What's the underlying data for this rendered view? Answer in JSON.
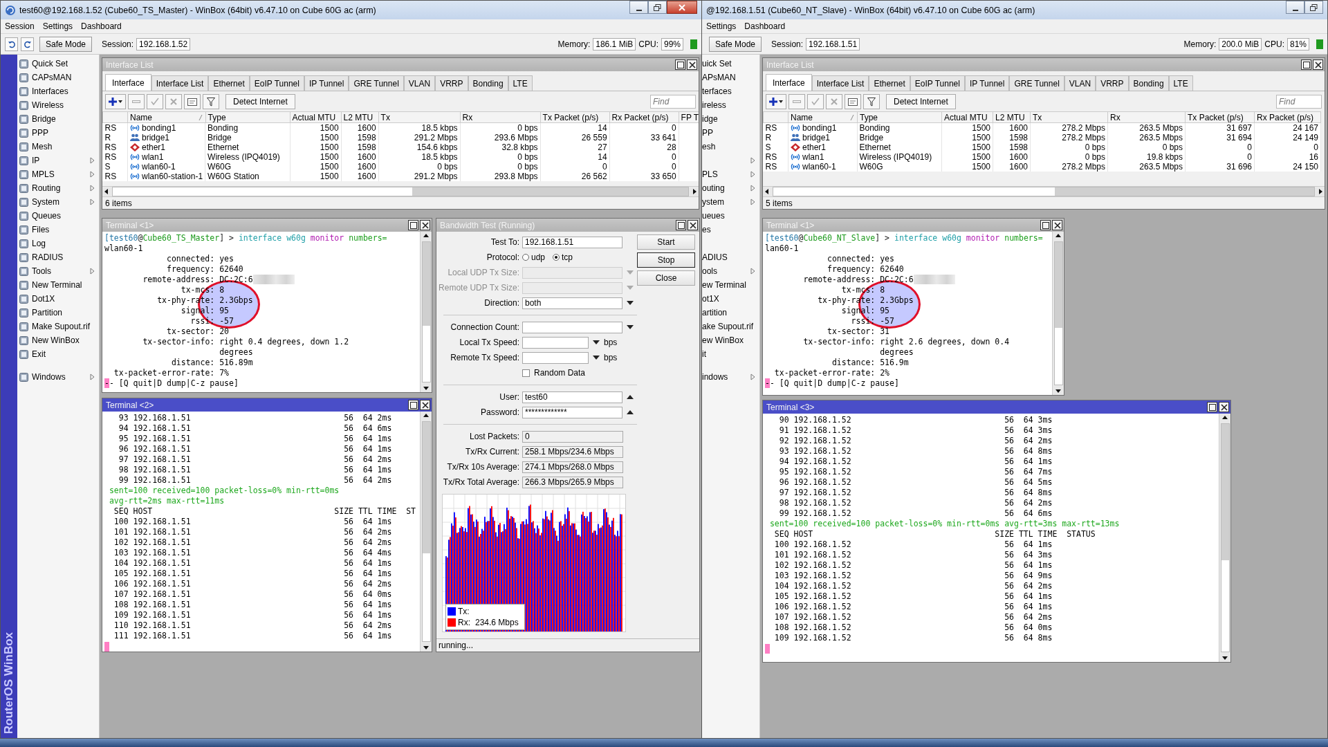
{
  "windows": [
    {
      "title": "test60@192.168.1.52 (Cube60_TS_Master) - WinBox (64bit) v6.47.10 on Cube 60G ac (arm)",
      "logo": true,
      "controls": [
        {
          "kind": "minimize"
        },
        {
          "kind": "restore"
        },
        {
          "kind": "close"
        }
      ],
      "menu": [
        "Session",
        "Settings",
        "Dashboard"
      ],
      "toolbar": {
        "history": true,
        "safe_mode": "Safe Mode",
        "session_label": "Session:",
        "session": "192.168.1.52",
        "memory_label": "Memory:",
        "memory": "186.1 MiB",
        "cpu_label": "CPU:",
        "cpu": "99%"
      },
      "brand": "RouterOS WinBox",
      "sidebar": {
        "icons": true,
        "items": [
          {
            "label": "Quick Set",
            "submenu": false
          },
          {
            "label": "CAPsMAN",
            "submenu": false
          },
          {
            "label": "Interfaces",
            "submenu": false
          },
          {
            "label": "Wireless",
            "submenu": false
          },
          {
            "label": "Bridge",
            "submenu": false
          },
          {
            "label": "PPP",
            "submenu": false
          },
          {
            "label": "Mesh",
            "submenu": false
          },
          {
            "label": "IP",
            "submenu": true
          },
          {
            "label": "MPLS",
            "submenu": true
          },
          {
            "label": "Routing",
            "submenu": true
          },
          {
            "label": "System",
            "submenu": true
          },
          {
            "label": "Queues",
            "submenu": false
          },
          {
            "label": "Files",
            "submenu": false
          },
          {
            "label": "Log",
            "submenu": false
          },
          {
            "label": "RADIUS",
            "submenu": false
          },
          {
            "label": "Tools",
            "submenu": true
          },
          {
            "label": "New Terminal",
            "submenu": false
          },
          {
            "label": "Dot1X",
            "submenu": false
          },
          {
            "label": "Partition",
            "submenu": false
          },
          {
            "label": "Make Supout.rif",
            "submenu": false
          },
          {
            "label": "New WinBox",
            "submenu": false
          },
          {
            "label": "Exit",
            "submenu": false
          }
        ],
        "bottom_items": [
          {
            "label": "Windows",
            "submenu": true
          }
        ]
      },
      "interface_list": {
        "title": "Interface List",
        "active": false,
        "tabs": [
          {
            "label": "Interface",
            "selected": true
          },
          {
            "label": "Interface List",
            "selected": false
          },
          {
            "label": "Ethernet",
            "selected": false
          },
          {
            "label": "EoIP Tunnel",
            "selected": false
          },
          {
            "label": "IP Tunnel",
            "selected": false
          },
          {
            "label": "GRE Tunnel",
            "selected": false
          },
          {
            "label": "VLAN",
            "selected": false
          },
          {
            "label": "VRRP",
            "selected": false
          },
          {
            "label": "Bonding",
            "selected": false
          },
          {
            "label": "LTE",
            "selected": false
          }
        ],
        "detect": "Detect Internet",
        "find_placeholder": "Find",
        "columns": [
          "Name",
          "Type",
          "Actual MTU",
          "L2 MTU",
          "Tx",
          "Rx",
          "Tx Packet (p/s)",
          "Rx Packet (p/s)",
          "FP T"
        ],
        "rows": [
          {
            "flags": "RS",
            "kind": "bonding",
            "name": "bonding1",
            "type": "Bonding",
            "actual_mtu": "1500",
            "l2_mtu": "1600",
            "tx": "18.5 kbps",
            "rx": "0 bps",
            "tx_packet": "14",
            "rx_packet": "0"
          },
          {
            "flags": "R",
            "kind": "bridge",
            "name": "bridge1",
            "type": "Bridge",
            "actual_mtu": "1500",
            "l2_mtu": "1598",
            "tx": "291.2 Mbps",
            "rx": "293.6 Mbps",
            "tx_packet": "26 559",
            "rx_packet": "33 641"
          },
          {
            "flags": "RS",
            "kind": "ethernet",
            "name": "ether1",
            "type": "Ethernet",
            "actual_mtu": "1500",
            "l2_mtu": "1598",
            "tx": "154.6 kbps",
            "rx": "32.8 kbps",
            "tx_packet": "27",
            "rx_packet": "28"
          },
          {
            "flags": "RS",
            "kind": "wireless",
            "name": "wlan1",
            "type": "Wireless (IPQ4019)",
            "actual_mtu": "1500",
            "l2_mtu": "1600",
            "tx": "18.5 kbps",
            "rx": "0 bps",
            "tx_packet": "14",
            "rx_packet": "0"
          },
          {
            "flags": "S",
            "kind": "wireless",
            "name": "wlan60-1",
            "type": "W60G",
            "actual_mtu": "1500",
            "l2_mtu": "1600",
            "tx": "0 bps",
            "rx": "0 bps",
            "tx_packet": "0",
            "rx_packet": "0"
          },
          {
            "flags": "RS",
            "kind": "wireless",
            "name": "wlan60-station-1",
            "type": "W60G Station",
            "actual_mtu": "1500",
            "l2_mtu": "1600",
            "tx": "291.2 Mbps",
            "rx": "293.8 Mbps",
            "tx_packet": "26 562",
            "rx_packet": "33 650"
          }
        ],
        "status": "6 items"
      },
      "terminals": [
        {
          "title": "Terminal <1>",
          "active": false,
          "highlight": true,
          "lines": [
            {
              "kind": "prompt",
              "parts": [
                {
                  "kind": "user",
                  "text": "[test60"
                },
                {
                  "kind": "plain",
                  "text": "@"
                },
                {
                  "kind": "host",
                  "text": "Cube60_TS_Master"
                },
                {
                  "kind": "plain",
                  "text": "] > "
                },
                {
                  "kind": "command",
                  "text": "interface w60g "
                },
                {
                  "kind": "keyword",
                  "text": "monitor "
                },
                {
                  "kind": "arg",
                  "text": "numbers="
                }
              ]
            },
            {
              "kind": "text",
              "text": "wlan60-1"
            },
            {
              "kind": "field",
              "label": "connected:",
              "value": "yes"
            },
            {
              "kind": "field",
              "label": "frequency:",
              "value": "62640"
            },
            {
              "kind": "field",
              "label": "remote-address:",
              "value": "DC:2C:6",
              "redacted": true
            },
            {
              "kind": "field",
              "label": "tx-mcs:",
              "value": "8"
            },
            {
              "kind": "field",
              "label": "tx-phy-rate:",
              "value": "2.3Gbps"
            },
            {
              "kind": "field",
              "label": "signal:",
              "value": "95"
            },
            {
              "kind": "field",
              "label": "rssi:",
              "value": "-57"
            },
            {
              "kind": "field",
              "label": "tx-sector:",
              "value": "20"
            },
            {
              "kind": "field",
              "label": "tx-sector-info:",
              "value": "right 0.4 degrees, down 1.2"
            },
            {
              "kind": "field",
              "value": "degrees"
            },
            {
              "kind": "field",
              "label": "distance:",
              "value": "516.89m"
            },
            {
              "kind": "field",
              "label": "tx-packet-error-rate:",
              "value": "7%"
            },
            {
              "kind": "status",
              "mark": "-",
              "text": "- [Q quit|D dump|C-z pause]"
            }
          ]
        },
        {
          "title": "Terminal <2>",
          "active": true,
          "highlight": false,
          "lines": [
            {
              "kind": "ping",
              "cols": [
                "93",
                "192.168.1.51",
                "56",
                "64",
                "2ms"
              ]
            },
            {
              "kind": "ping",
              "cols": [
                "94",
                "192.168.1.51",
                "56",
                "64",
                "6ms"
              ]
            },
            {
              "kind": "ping",
              "cols": [
                "95",
                "192.168.1.51",
                "56",
                "64",
                "1ms"
              ]
            },
            {
              "kind": "ping",
              "cols": [
                "96",
                "192.168.1.51",
                "56",
                "64",
                "1ms"
              ]
            },
            {
              "kind": "ping",
              "cols": [
                "97",
                "192.168.1.51",
                "56",
                "64",
                "2ms"
              ]
            },
            {
              "kind": "ping",
              "cols": [
                "98",
                "192.168.1.51",
                "56",
                "64",
                "1ms"
              ]
            },
            {
              "kind": "ping",
              "cols": [
                "99",
                "192.168.1.51",
                "56",
                "64",
                "2ms"
              ]
            },
            {
              "kind": "summary",
              "text": "sent=100 received=100 packet-loss=0% min-rtt=0ms"
            },
            {
              "kind": "summary",
              "text": "avg-rtt=2ms max-rtt=11ms"
            },
            {
              "kind": "header",
              "cols": [
                "SEQ",
                "HOST",
                "SIZE",
                "TTL",
                "TIME",
                "ST"
              ]
            },
            {
              "kind": "ping",
              "cols": [
                "100",
                "192.168.1.51",
                "56",
                "64",
                "1ms"
              ]
            },
            {
              "kind": "ping",
              "cols": [
                "101",
                "192.168.1.51",
                "56",
                "64",
                "2ms"
              ]
            },
            {
              "kind": "ping",
              "cols": [
                "102",
                "192.168.1.51",
                "56",
                "64",
                "2ms"
              ]
            },
            {
              "kind": "ping",
              "cols": [
                "103",
                "192.168.1.51",
                "56",
                "64",
                "4ms"
              ]
            },
            {
              "kind": "ping",
              "cols": [
                "104",
                "192.168.1.51",
                "56",
                "64",
                "1ms"
              ]
            },
            {
              "kind": "ping",
              "cols": [
                "105",
                "192.168.1.51",
                "56",
                "64",
                "1ms"
              ]
            },
            {
              "kind": "ping",
              "cols": [
                "106",
                "192.168.1.51",
                "56",
                "64",
                "2ms"
              ]
            },
            {
              "kind": "ping",
              "cols": [
                "107",
                "192.168.1.51",
                "56",
                "64",
                "0ms"
              ]
            },
            {
              "kind": "ping",
              "cols": [
                "108",
                "192.168.1.51",
                "56",
                "64",
                "1ms"
              ]
            },
            {
              "kind": "ping",
              "cols": [
                "109",
                "192.168.1.51",
                "56",
                "64",
                "1ms"
              ]
            },
            {
              "kind": "ping",
              "cols": [
                "110",
                "192.168.1.51",
                "56",
                "64",
                "2ms"
              ]
            },
            {
              "kind": "ping",
              "cols": [
                "111",
                "192.168.1.51",
                "56",
                "64",
                "1ms"
              ]
            },
            {
              "kind": "cursor"
            }
          ]
        }
      ],
      "bandwidth_test": {
        "title": "Bandwidth Test (Running)",
        "active": false,
        "rows": [
          {
            "kind": "input",
            "label": "Test To:",
            "value": "192.168.1.51",
            "disabled": false
          },
          {
            "kind": "radio",
            "label": "Protocol:",
            "disabled": false,
            "options": [
              {
                "label": "udp",
                "selected": false
              },
              {
                "label": "tcp",
                "selected": true
              }
            ]
          },
          {
            "kind": "dropdown",
            "label": "Local UDP Tx Size:",
            "disabled": true
          },
          {
            "kind": "dropdown",
            "label": "Remote UDP Tx Size:",
            "disabled": true
          },
          {
            "kind": "dropdown",
            "label": "Direction:",
            "value": "both",
            "disabled": false
          },
          {
            "kind": "separator"
          },
          {
            "kind": "dropdown",
            "label": "Connection Count:",
            "disabled": false
          },
          {
            "kind": "speed",
            "label": "Local Tx Speed:",
            "unit": "bps",
            "disabled": false
          },
          {
            "kind": "speed",
            "label": "Remote Tx Speed:",
            "unit": "bps",
            "disabled": false
          },
          {
            "kind": "checkbox",
            "label": "Random Data",
            "checked": false,
            "disabled": false
          },
          {
            "kind": "separator"
          },
          {
            "kind": "collapsible",
            "label": "User:",
            "value": "test60",
            "disabled": false
          },
          {
            "kind": "collapsible",
            "label": "Password:",
            "value": "*************",
            "disabled": false
          },
          {
            "kind": "separator"
          },
          {
            "kind": "readonly",
            "label": "Lost Packets:",
            "value": "0",
            "disabled": false
          },
          {
            "kind": "readonly",
            "label": "Tx/Rx Current:",
            "value": "258.1 Mbps/234.6 Mbps",
            "disabled": false
          },
          {
            "kind": "readonly",
            "label": "Tx/Rx 10s Average:",
            "value": "274.1 Mbps/268.0 Mbps",
            "disabled": false
          },
          {
            "kind": "readonly",
            "label": "Tx/Rx Total Average:",
            "value": "266.3 Mbps/265.9 Mbps",
            "disabled": false
          }
        ],
        "buttons": [
          {
            "label": "Start",
            "focused": false
          },
          {
            "label": "Stop",
            "focused": true
          },
          {
            "label": "Close",
            "focused": false
          }
        ],
        "legend": [
          {
            "label": "Tx:",
            "color": "#0000ff"
          },
          {
            "label": "Rx:",
            "value": "234.6 Mbps",
            "color": "#ff0000"
          }
        ],
        "status": "running..."
      }
    },
    {
      "title": "@192.168.1.51 (Cube60_NT_Slave) - WinBox (64bit) v6.47.10 on Cube 60G ac (arm)",
      "logo": false,
      "controls": [
        {
          "kind": "minimize"
        },
        {
          "kind": "restore"
        }
      ],
      "menu": [
        "Settings",
        "Dashboard"
      ],
      "toolbar": {
        "history": false,
        "safe_mode": "Safe Mode",
        "session_label": "Session:",
        "session": "192.168.1.51",
        "memory_label": "Memory:",
        "memory": "200.0 MiB",
        "cpu_label": "CPU:",
        "cpu": "81%"
      },
      "sidebar": {
        "icons": false,
        "items": [
          {
            "label": "uick Set",
            "submenu": false
          },
          {
            "label": "APsMAN",
            "submenu": false
          },
          {
            "label": "terfaces",
            "submenu": false
          },
          {
            "label": "ireless",
            "submenu": false
          },
          {
            "label": "idge",
            "submenu": false
          },
          {
            "label": "PP",
            "submenu": false
          },
          {
            "label": "esh",
            "submenu": false
          },
          {
            "submenu": true
          },
          {
            "label": "PLS",
            "submenu": true
          },
          {
            "label": "outing",
            "submenu": true
          },
          {
            "label": "ystem",
            "submenu": true
          },
          {
            "label": "ueues",
            "submenu": false
          },
          {
            "label": "es",
            "submenu": false
          },
          {
            "submenu": false
          },
          {
            "label": "ADIUS",
            "submenu": false
          },
          {
            "label": "ools",
            "submenu": true
          },
          {
            "label": "ew Terminal",
            "submenu": false
          },
          {
            "label": "ot1X",
            "submenu": false
          },
          {
            "label": "artition",
            "submenu": false
          },
          {
            "label": "ake Supout.rif",
            "submenu": false
          },
          {
            "label": "ew WinBox",
            "submenu": false
          },
          {
            "label": "it",
            "submenu": false
          }
        ],
        "bottom_items": [
          {
            "label": "indows",
            "submenu": true
          }
        ]
      },
      "interface_list": {
        "title": "Interface List",
        "active": false,
        "tabs": [
          {
            "label": "Interface",
            "selected": true
          },
          {
            "label": "Interface List",
            "selected": false
          },
          {
            "label": "Ethernet",
            "selected": false
          },
          {
            "label": "EoIP Tunnel",
            "selected": false
          },
          {
            "label": "IP Tunnel",
            "selected": false
          },
          {
            "label": "GRE Tunnel",
            "selected": false
          },
          {
            "label": "VLAN",
            "selected": false
          },
          {
            "label": "VRRP",
            "selected": false
          },
          {
            "label": "Bonding",
            "selected": false
          },
          {
            "label": "LTE",
            "selected": false
          }
        ],
        "detect": "Detect Internet",
        "find_placeholder": "Find",
        "columns": [
          "Name",
          "Type",
          "Actual MTU",
          "L2 MTU",
          "Tx",
          "Rx",
          "Tx Packet (p/s)",
          "Rx Packet (p/s)"
        ],
        "rows": [
          {
            "flags": "RS",
            "kind": "bonding",
            "name": "bonding1",
            "type": "Bonding",
            "actual_mtu": "1500",
            "l2_mtu": "1600",
            "tx": "278.2 Mbps",
            "rx": "263.5 Mbps",
            "tx_packet": "31 697",
            "rx_packet": "24 167"
          },
          {
            "flags": "R",
            "kind": "bridge",
            "name": "bridge1",
            "type": "Bridge",
            "actual_mtu": "1500",
            "l2_mtu": "1598",
            "tx": "278.2 Mbps",
            "rx": "263.5 Mbps",
            "tx_packet": "31 694",
            "rx_packet": "24 149"
          },
          {
            "flags": "S",
            "kind": "ethernet",
            "name": "ether1",
            "type": "Ethernet",
            "actual_mtu": "1500",
            "l2_mtu": "1598",
            "tx": "0 bps",
            "rx": "0 bps",
            "tx_packet": "0",
            "rx_packet": "0"
          },
          {
            "flags": "RS",
            "kind": "wireless",
            "name": "wlan1",
            "type": "Wireless (IPQ4019)",
            "actual_mtu": "1500",
            "l2_mtu": "1600",
            "tx": "0 bps",
            "rx": "19.8 kbps",
            "tx_packet": "0",
            "rx_packet": "16"
          },
          {
            "flags": "RS",
            "kind": "wireless",
            "name": "wlan60-1",
            "type": "W60G",
            "actual_mtu": "1500",
            "l2_mtu": "1600",
            "tx": "278.2 Mbps",
            "rx": "263.5 Mbps",
            "tx_packet": "31 696",
            "rx_packet": "24 150"
          }
        ],
        "status": "5 items"
      },
      "terminals": [
        {
          "title": "Terminal <1>",
          "active": false,
          "highlight": true,
          "lines": [
            {
              "kind": "prompt",
              "parts": [
                {
                  "kind": "user",
                  "text": "[test60"
                },
                {
                  "kind": "plain",
                  "text": "@"
                },
                {
                  "kind": "host",
                  "text": "Cube60_NT_Slave"
                },
                {
                  "kind": "plain",
                  "text": "] > "
                },
                {
                  "kind": "command",
                  "text": "interface w60g "
                },
                {
                  "kind": "keyword",
                  "text": "monitor "
                },
                {
                  "kind": "arg",
                  "text": "numbers="
                }
              ]
            },
            {
              "kind": "text",
              "text": "lan60-1"
            },
            {
              "kind": "field",
              "label": "connected:",
              "value": "yes"
            },
            {
              "kind": "field",
              "label": "frequency:",
              "value": "62640"
            },
            {
              "kind": "field",
              "label": "remote-address:",
              "value": "DC:2C:6",
              "redacted": true
            },
            {
              "kind": "field",
              "label": "tx-mcs:",
              "value": "8"
            },
            {
              "kind": "field",
              "label": "tx-phy-rate:",
              "value": "2.3Gbps"
            },
            {
              "kind": "field",
              "label": "signal:",
              "value": "95"
            },
            {
              "kind": "field",
              "label": "rssi:",
              "value": "-57"
            },
            {
              "kind": "field",
              "label": "tx-sector:",
              "value": "31"
            },
            {
              "kind": "field",
              "label": "tx-sector-info:",
              "value": "right 2.6 degrees, down 0.4"
            },
            {
              "kind": "field",
              "value": "degrees"
            },
            {
              "kind": "field",
              "label": "distance:",
              "value": "516.9m"
            },
            {
              "kind": "field",
              "label": "tx-packet-error-rate:",
              "value": "2%"
            },
            {
              "kind": "status",
              "mark": "-",
              "text": "- [Q quit|D dump|C-z pause]"
            }
          ]
        },
        {
          "title": "Terminal <3>",
          "active": true,
          "highlight": false,
          "lines": [
            {
              "kind": "ping",
              "cols": [
                "90",
                "192.168.1.52",
                "56",
                "64",
                "3ms"
              ]
            },
            {
              "kind": "ping",
              "cols": [
                "91",
                "192.168.1.52",
                "56",
                "64",
                "3ms"
              ]
            },
            {
              "kind": "ping",
              "cols": [
                "92",
                "192.168.1.52",
                "56",
                "64",
                "2ms"
              ]
            },
            {
              "kind": "ping",
              "cols": [
                "93",
                "192.168.1.52",
                "56",
                "64",
                "8ms"
              ]
            },
            {
              "kind": "ping",
              "cols": [
                "94",
                "192.168.1.52",
                "56",
                "64",
                "1ms"
              ]
            },
            {
              "kind": "ping",
              "cols": [
                "95",
                "192.168.1.52",
                "56",
                "64",
                "7ms"
              ]
            },
            {
              "kind": "ping",
              "cols": [
                "96",
                "192.168.1.52",
                "56",
                "64",
                "5ms"
              ]
            },
            {
              "kind": "ping",
              "cols": [
                "97",
                "192.168.1.52",
                "56",
                "64",
                "8ms"
              ]
            },
            {
              "kind": "ping",
              "cols": [
                "98",
                "192.168.1.52",
                "56",
                "64",
                "2ms"
              ]
            },
            {
              "kind": "ping",
              "cols": [
                "99",
                "192.168.1.52",
                "56",
                "64",
                "6ms"
              ]
            },
            {
              "kind": "summary",
              "text": "sent=100 received=100 packet-loss=0% min-rtt=0ms avg-rtt=3ms max-rtt=13ms"
            },
            {
              "kind": "header",
              "cols": [
                "SEQ",
                "HOST",
                "SIZE",
                "TTL",
                "TIME",
                "STATUS"
              ]
            },
            {
              "kind": "ping",
              "cols": [
                "100",
                "192.168.1.52",
                "56",
                "64",
                "1ms"
              ]
            },
            {
              "kind": "ping",
              "cols": [
                "101",
                "192.168.1.52",
                "56",
                "64",
                "3ms"
              ]
            },
            {
              "kind": "ping",
              "cols": [
                "102",
                "192.168.1.52",
                "56",
                "64",
                "1ms"
              ]
            },
            {
              "kind": "ping",
              "cols": [
                "103",
                "192.168.1.52",
                "56",
                "64",
                "9ms"
              ]
            },
            {
              "kind": "ping",
              "cols": [
                "104",
                "192.168.1.52",
                "56",
                "64",
                "2ms"
              ]
            },
            {
              "kind": "ping",
              "cols": [
                "105",
                "192.168.1.52",
                "56",
                "64",
                "1ms"
              ]
            },
            {
              "kind": "ping",
              "cols": [
                "106",
                "192.168.1.52",
                "56",
                "64",
                "1ms"
              ]
            },
            {
              "kind": "ping",
              "cols": [
                "107",
                "192.168.1.52",
                "56",
                "64",
                "2ms"
              ]
            },
            {
              "kind": "ping",
              "cols": [
                "108",
                "192.168.1.52",
                "56",
                "64",
                "0ms"
              ]
            },
            {
              "kind": "ping",
              "cols": [
                "109",
                "192.168.1.52",
                "56",
                "64",
                "8ms"
              ]
            },
            {
              "kind": "cursor"
            }
          ]
        }
      ]
    }
  ]
}
